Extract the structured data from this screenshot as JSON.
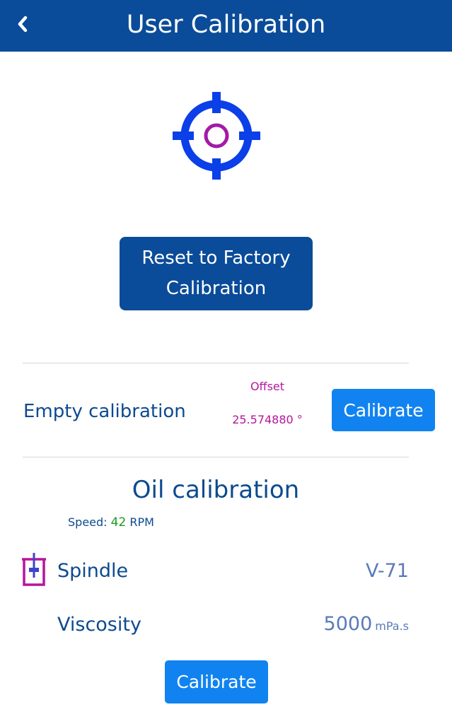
{
  "header": {
    "title": "User Calibration",
    "back_icon": "chevron-left-icon"
  },
  "target_icon": "crosshair-target-icon",
  "reset_button": {
    "label": "Reset to Factory Calibration"
  },
  "empty_calibration": {
    "label": "Empty calibration",
    "offset_label": "Offset",
    "offset_value": "25.574880 °",
    "button_label": "Calibrate"
  },
  "oil_calibration": {
    "title": "Oil calibration",
    "speed_label": "Speed:",
    "speed_value": "42",
    "speed_unit": "RPM",
    "spindle_icon": "spindle-icon",
    "spindle_label": "Spindle",
    "spindle_value": "V-71",
    "viscosity_label": "Viscosity",
    "viscosity_value": "5000",
    "viscosity_unit": "mPa.s",
    "button_label": "Calibrate"
  },
  "colors": {
    "header_bg": "#0a4c99",
    "primary_button": "#1183f0",
    "accent_magenta": "#b5179a",
    "text_blue": "#0d4a8f",
    "value_blue": "#5a7ab8",
    "speed_green": "#1a9b1a",
    "target_blue": "#0b3fe8"
  }
}
